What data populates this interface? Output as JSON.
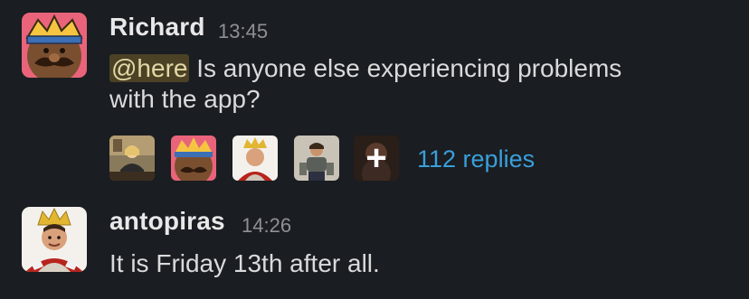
{
  "messages": [
    {
      "author": "Richard",
      "time": "13:45",
      "mention": "@here",
      "text_line1": " Is anyone else experiencing problems",
      "text_line2": "with the app?",
      "thread": {
        "more_symbol": "+",
        "replies_label": "112 replies"
      }
    },
    {
      "author": "antopiras",
      "time": "14:26",
      "text": "It is Friday 13th after all."
    }
  ],
  "colors": {
    "background": "#1a1d21",
    "mention_bg": "#4b4226",
    "link": "#3a9fdb"
  },
  "icons": {
    "richard_avatar": "mustache-cartoon-avatar",
    "antopiras_avatar": "crowned-man-avatar"
  }
}
